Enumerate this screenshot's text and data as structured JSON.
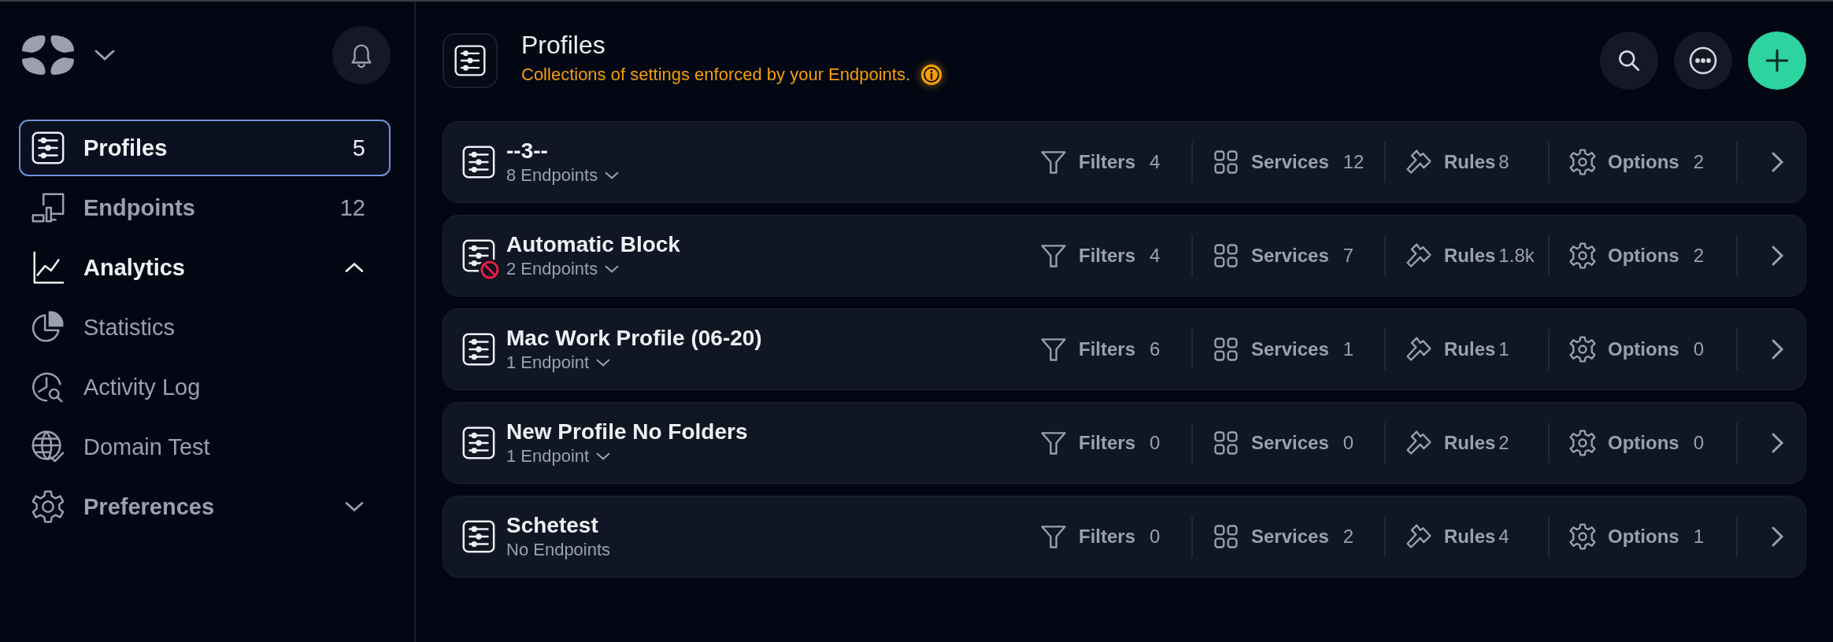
{
  "sidebar": {
    "nav": [
      {
        "kind": "profiles",
        "label": "Profiles",
        "count": "5",
        "selected": true
      },
      {
        "kind": "endpoints",
        "label": "Endpoints",
        "count": "12",
        "selected": false
      },
      {
        "kind": "analytics",
        "label": "Analytics",
        "selected": false,
        "expanded": true,
        "children": [
          {
            "kind": "statistics",
            "label": "Statistics",
            "selected": false
          },
          {
            "kind": "activity",
            "label": "Activity Log",
            "selected": false
          },
          {
            "kind": "domain",
            "label": "Domain Test",
            "selected": false
          }
        ]
      },
      {
        "kind": "preferences",
        "label": "Preferences",
        "selected": false,
        "expanded": false
      }
    ]
  },
  "header": {
    "title": "Profiles",
    "subtitle": "Collections of settings enforced by your Endpoints."
  },
  "profiles": [
    {
      "name": "--3--",
      "endpoints": "8 Endpoints",
      "expandable": true,
      "blocked": false,
      "stats": [
        {
          "kind": "filters",
          "label": "Filters",
          "count": "4"
        },
        {
          "kind": "services",
          "label": "Services",
          "count": "12"
        },
        {
          "kind": "rules",
          "label": "Rules",
          "count": "8"
        },
        {
          "kind": "options",
          "label": "Options",
          "count": "2"
        }
      ]
    },
    {
      "name": "Automatic Block",
      "endpoints": "2 Endpoints",
      "expandable": true,
      "blocked": true,
      "stats": [
        {
          "kind": "filters",
          "label": "Filters",
          "count": "4"
        },
        {
          "kind": "services",
          "label": "Services",
          "count": "7"
        },
        {
          "kind": "rules",
          "label": "Rules",
          "count": "1.8k"
        },
        {
          "kind": "options",
          "label": "Options",
          "count": "2"
        }
      ]
    },
    {
      "name": "Mac Work Profile (06-20)",
      "endpoints": "1 Endpoint",
      "expandable": true,
      "blocked": false,
      "stats": [
        {
          "kind": "filters",
          "label": "Filters",
          "count": "6"
        },
        {
          "kind": "services",
          "label": "Services",
          "count": "1"
        },
        {
          "kind": "rules",
          "label": "Rules",
          "count": "1"
        },
        {
          "kind": "options",
          "label": "Options",
          "count": "0"
        }
      ]
    },
    {
      "name": "New Profile No Folders",
      "endpoints": "1 Endpoint",
      "expandable": true,
      "blocked": false,
      "stats": [
        {
          "kind": "filters",
          "label": "Filters",
          "count": "0"
        },
        {
          "kind": "services",
          "label": "Services",
          "count": "0"
        },
        {
          "kind": "rules",
          "label": "Rules",
          "count": "2"
        },
        {
          "kind": "options",
          "label": "Options",
          "count": "0"
        }
      ]
    },
    {
      "name": "Schetest",
      "endpoints": "No Endpoints",
      "expandable": false,
      "blocked": false,
      "stats": [
        {
          "kind": "filters",
          "label": "Filters",
          "count": "0"
        },
        {
          "kind": "services",
          "label": "Services",
          "count": "2"
        },
        {
          "kind": "rules",
          "label": "Rules",
          "count": "4"
        },
        {
          "kind": "options",
          "label": "Options",
          "count": "1"
        }
      ]
    }
  ]
}
